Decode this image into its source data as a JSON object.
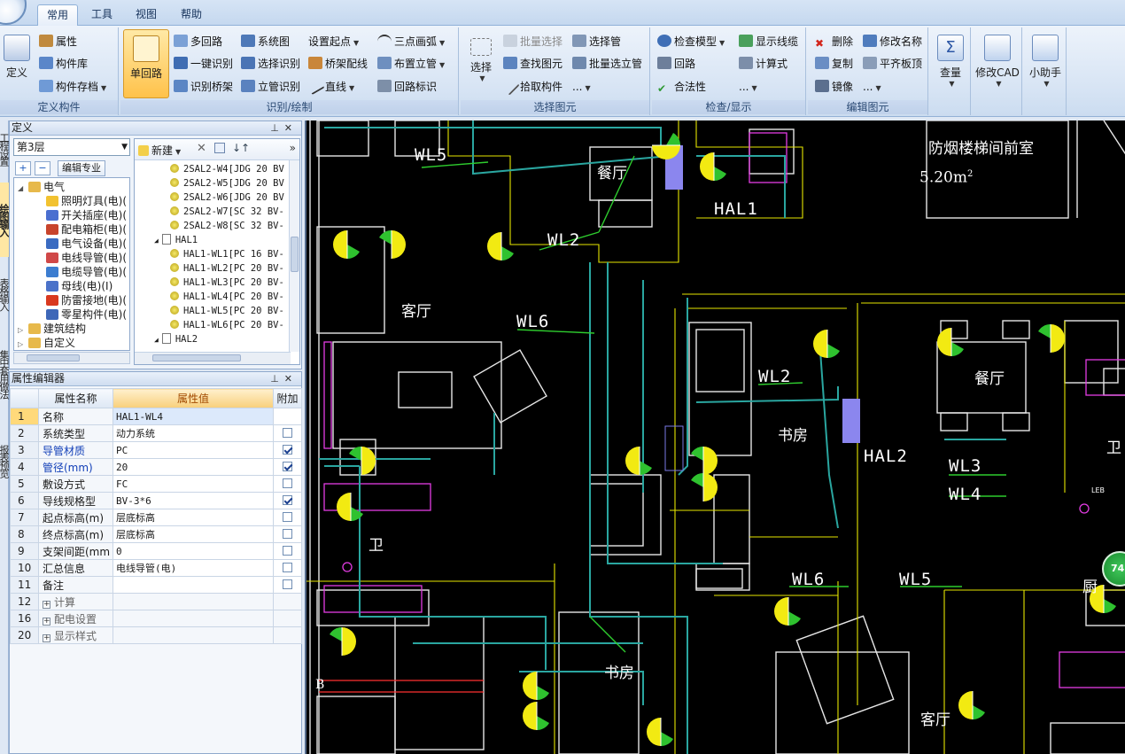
{
  "tabs": [
    "常用",
    "工具",
    "视图",
    "帮助"
  ],
  "ribbon": {
    "g1": {
      "label": "定义构件",
      "define": "定义",
      "attr": "属性",
      "lib": "构件库",
      "store": "构件存档"
    },
    "g2": {
      "label": "识别/绘制",
      "single": "单回路",
      "multi": "多回路",
      "onekey": "一键识别",
      "bridge": "识别桥架",
      "sys": "系统图",
      "sel_id": "选择识别",
      "riser": "立管识别",
      "start": "设置起点",
      "tray": "桥架配线",
      "line": "直线",
      "arc": "三点画弧",
      "place_riser": "布置立管",
      "loop_tag": "回路标识"
    },
    "g3": {
      "label": "选择图元",
      "select": "选择",
      "batch_sel": "批量选择",
      "find": "查找图元",
      "pick": "拾取构件",
      "sel_pipe": "选择管",
      "batch_riser": "批量选立管",
      "more": "..."
    },
    "g4": {
      "label": "检查/显示",
      "check": "检查模型",
      "loop": "回路",
      "legal": "合法性",
      "show_lines": "显示线缆",
      "calc": "计算式",
      "more": "..."
    },
    "g5": {
      "label": "编辑图元",
      "del": "删除",
      "copy": "复制",
      "mirror": "镜像",
      "rename": "修改名称",
      "flat": "平齐板顶",
      "more": "..."
    },
    "g6": {
      "qty": "查量",
      "cad": "修改CAD",
      "helper": "小助手"
    }
  },
  "left_strip": [
    "工程设置",
    "绘图输入",
    "表格输入",
    "集中套用做法",
    "报表预览"
  ],
  "definition_panel": {
    "title": "定义",
    "floor": "第3层",
    "edit_spec": "编辑专业",
    "tree": [
      {
        "label": "电气",
        "level": 0,
        "icon": "folder-icon",
        "color": "#e7b94b"
      },
      {
        "label": "照明灯具(电)(",
        "level": 1,
        "icon": "bulb-icon",
        "color": "#f2c230"
      },
      {
        "label": "开关插座(电)(",
        "level": 1,
        "icon": "switch-icon",
        "color": "#4a6fd0"
      },
      {
        "label": "配电箱柜(电)(",
        "level": 1,
        "icon": "cabinet-icon",
        "color": "#c8442c"
      },
      {
        "label": "电气设备(电)(",
        "level": 1,
        "icon": "equipment-icon",
        "color": "#3a6bc1"
      },
      {
        "label": "电线导管(电)(",
        "level": 1,
        "icon": "conduit-icon",
        "color": "#d04848"
      },
      {
        "label": "电缆导管(电)(",
        "level": 1,
        "icon": "cable-icon",
        "color": "#3c7dd0"
      },
      {
        "label": "母线(电)(I)",
        "level": 1,
        "icon": "busbar-icon",
        "color": "#4b72c9"
      },
      {
        "label": "防雷接地(电)(",
        "level": 1,
        "icon": "lightning-icon",
        "color": "#d9391f"
      },
      {
        "label": "零星构件(电)(",
        "level": 1,
        "icon": "misc-icon",
        "color": "#3e67b8"
      },
      {
        "label": "建筑结构",
        "level": 0,
        "icon": "folder-icon",
        "color": "#e7b94b"
      },
      {
        "label": "自定义",
        "level": 0,
        "icon": "folder-icon",
        "color": "#e7b94b"
      }
    ],
    "list_toolbar": {
      "new": "新建"
    },
    "list": [
      {
        "label": "2SAL2-W4[JDG 20 BV",
        "type": "item"
      },
      {
        "label": "2SAL2-W5[JDG 20 BV",
        "type": "item"
      },
      {
        "label": "2SAL2-W6[JDG 20 BV",
        "type": "item"
      },
      {
        "label": "2SAL2-W7[SC 32 BV-",
        "type": "item"
      },
      {
        "label": "2SAL2-W8[SC 32 BV-",
        "type": "item"
      },
      {
        "label": "HAL1",
        "type": "group"
      },
      {
        "label": "HAL1-WL1[PC 16 BV-",
        "type": "item"
      },
      {
        "label": "HAL1-WL2[PC 20 BV-",
        "type": "item"
      },
      {
        "label": "HAL1-WL3[PC 20 BV-",
        "type": "item"
      },
      {
        "label": "HAL1-WL4[PC 20 BV-",
        "type": "item"
      },
      {
        "label": "HAL1-WL5[PC 20 BV-",
        "type": "item"
      },
      {
        "label": "HAL1-WL6[PC 20 BV-",
        "type": "item"
      },
      {
        "label": "HAL2",
        "type": "group"
      }
    ]
  },
  "property_editor": {
    "title": "属性编辑器",
    "headers": {
      "name": "属性名称",
      "value": "属性值",
      "extra": "附加"
    },
    "rows": [
      {
        "num": "1",
        "name": "名称",
        "value": "HAL1-WL4",
        "checked": null,
        "style": "sel"
      },
      {
        "num": "2",
        "name": "系统类型",
        "value": "动力系统",
        "checked": false,
        "style": ""
      },
      {
        "num": "3",
        "name": "导管材质",
        "value": "PC",
        "checked": true,
        "style": "blue"
      },
      {
        "num": "4",
        "name": "管径(mm)",
        "value": "20",
        "checked": true,
        "style": "blue"
      },
      {
        "num": "5",
        "name": "敷设方式",
        "value": "FC",
        "checked": false,
        "style": ""
      },
      {
        "num": "6",
        "name": "导线规格型",
        "value": "BV-3*6",
        "checked": true,
        "style": ""
      },
      {
        "num": "7",
        "name": "起点标高(m)",
        "value": "层底标高",
        "checked": false,
        "style": ""
      },
      {
        "num": "8",
        "name": "终点标高(m)",
        "value": "层底标高",
        "checked": false,
        "style": ""
      },
      {
        "num": "9",
        "name": "支架间距(mm",
        "value": "0",
        "checked": false,
        "style": ""
      },
      {
        "num": "10",
        "name": "汇总信息",
        "value": "电线导管(电)",
        "checked": false,
        "style": ""
      },
      {
        "num": "11",
        "name": "备注",
        "value": "",
        "checked": false,
        "style": ""
      },
      {
        "num": "12",
        "name": "计算",
        "value": "",
        "checked": null,
        "style": "grp"
      },
      {
        "num": "16",
        "name": "配电设置",
        "value": "",
        "checked": null,
        "style": "grp"
      },
      {
        "num": "20",
        "name": "显示样式",
        "value": "",
        "checked": null,
        "style": "grp"
      }
    ]
  },
  "cad": {
    "labels": {
      "wl5_top": "WL5",
      "wl2_top": "WL2",
      "wl6_mid": "WL6",
      "wl2_right": "WL2",
      "wl3": "WL3",
      "wl4": "WL4",
      "wl6_bottom": "WL6",
      "wl5_bottom": "WL5",
      "hal1": "HAL1",
      "hal2": "HAL2",
      "dining1": "餐厅",
      "dining2": "餐厅",
      "living1": "客厅",
      "living2": "客厅",
      "study1": "书房",
      "study2": "书房",
      "bath1": "卫",
      "bath2": "卫",
      "kitchen": "厨",
      "stair": "防烟楼梯间前室",
      "area": "5.20m",
      "area_sup": "2",
      "axis_b": "B",
      "leb": "LEB"
    },
    "badge": "74"
  }
}
